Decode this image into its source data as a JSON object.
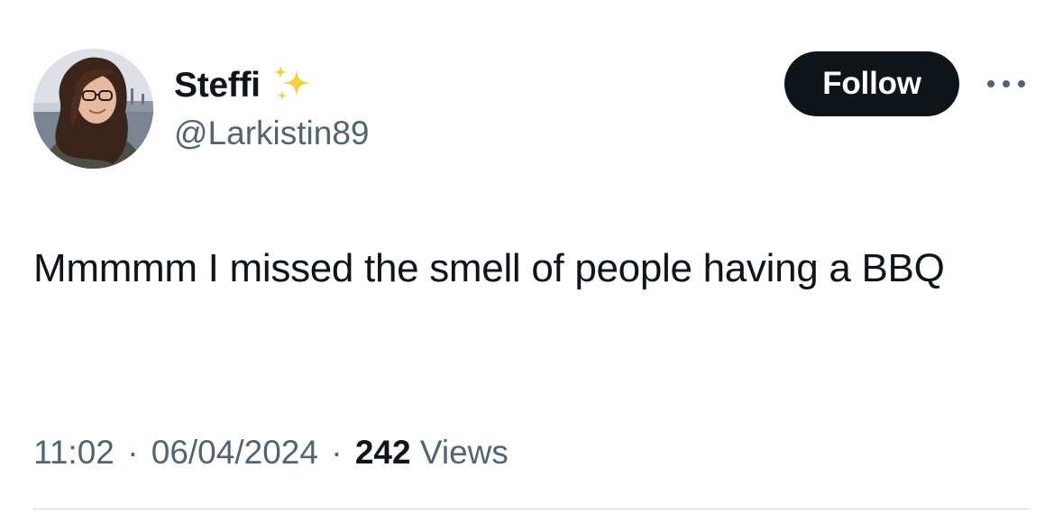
{
  "author": {
    "display_name": "Steffi",
    "handle": "@Larkistin89",
    "badge_icon": "sparkles-icon"
  },
  "actions": {
    "follow_label": "Follow",
    "more_icon": "more-horizontal-icon"
  },
  "tweet": {
    "text": "Mmmmm I missed the smell of people having a BBQ"
  },
  "meta": {
    "time": "11:02",
    "separator": "·",
    "date": "06/04/2024",
    "views_count": "242",
    "views_label": "Views"
  },
  "colors": {
    "text_primary": "#0f1419",
    "text_secondary": "#536471",
    "follow_bg": "#0f1419",
    "sparkle": "#f4c430",
    "divider": "#cfd9de"
  }
}
